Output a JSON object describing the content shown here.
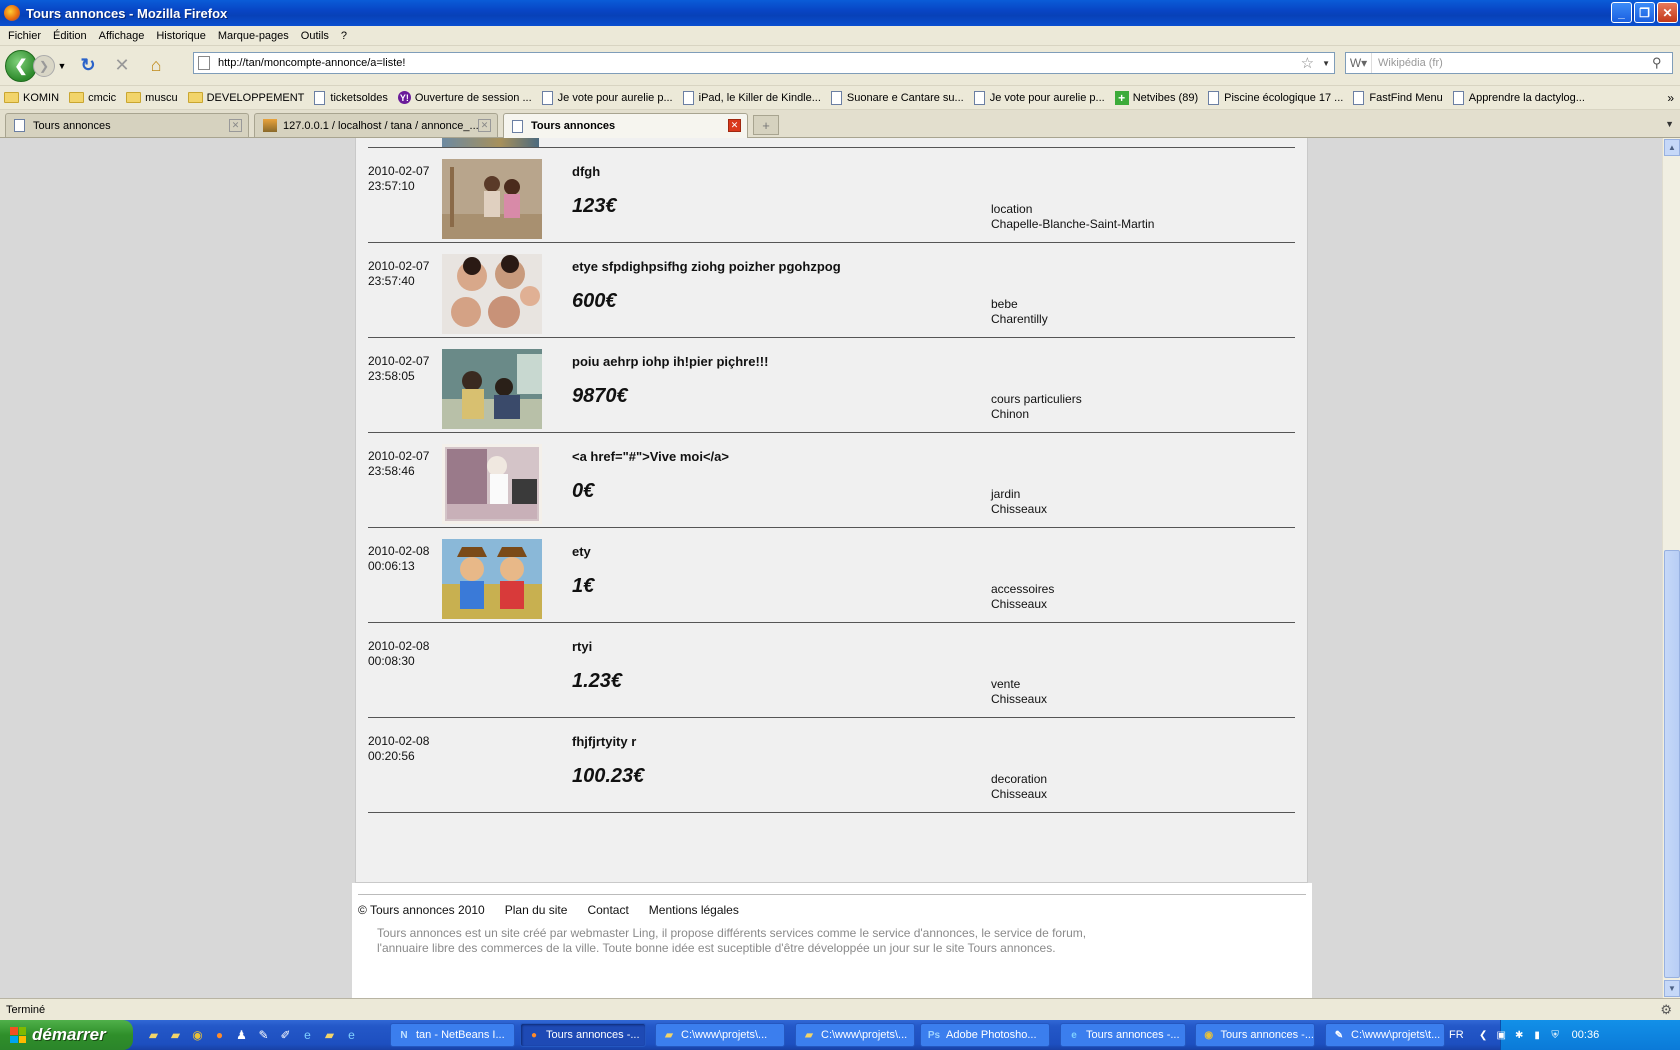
{
  "window": {
    "title": "Tours annonces - Mozilla Firefox",
    "buttons": {
      "minimize": "_",
      "maximize": "❐",
      "close": "✕"
    }
  },
  "menu": [
    "Fichier",
    "Édition",
    "Affichage",
    "Historique",
    "Marque-pages",
    "Outils",
    "?"
  ],
  "nav": {
    "url": "http://tan/moncompte-annonce/a=liste!",
    "search_placeholder": "Wikipédia (fr)"
  },
  "bookmarks": [
    {
      "label": "KOMIN",
      "icon": "folder-icon"
    },
    {
      "label": "cmcic",
      "icon": "folder-icon"
    },
    {
      "label": "muscu",
      "icon": "folder-icon"
    },
    {
      "label": "DEVELOPPEMENT",
      "icon": "folder-icon"
    },
    {
      "label": "ticketsoldes",
      "icon": "page-icon"
    },
    {
      "label": "Ouverture de session ...",
      "icon": "yahoo-icon"
    },
    {
      "label": "Je vote pour aurelie p...",
      "icon": "page-icon"
    },
    {
      "label": "iPad, le Killer de Kindle...",
      "icon": "page-icon"
    },
    {
      "label": "Suonare e Cantare su...",
      "icon": "page-icon"
    },
    {
      "label": "Je vote pour aurelie p...",
      "icon": "page-icon"
    },
    {
      "label": "Netvibes (89)",
      "icon": "netvibes-icon"
    },
    {
      "label": "Piscine écologique 17 ...",
      "icon": "page-icon"
    },
    {
      "label": "FastFind Menu",
      "icon": "page-icon"
    },
    {
      "label": "Apprendre la dactylog...",
      "icon": "page-icon"
    }
  ],
  "bookmarks_more": "»",
  "tabs": [
    {
      "label": "Tours annonces",
      "active": false
    },
    {
      "label": "127.0.0.1 / localhost / tana / annonce_...",
      "active": false
    },
    {
      "label": "Tours annonces",
      "active": true
    }
  ],
  "listings": [
    {
      "date": "2010-02-07",
      "time": "23:57:10",
      "title": "dfgh",
      "price": "123€",
      "category": "location",
      "city": "Chapelle-Blanche-Saint-Martin",
      "image": "photo-two-girls"
    },
    {
      "date": "2010-02-07",
      "time": "23:57:40",
      "title": "etye sfpdighpsifhg ziohg poizher pgohzpog",
      "price": "600€",
      "category": "bebe",
      "city": "Charentilly",
      "image": "photo-faces-group"
    },
    {
      "date": "2010-02-07",
      "time": "23:58:05",
      "title": "poiu aehrp iohp ih!pier piçhre!!!",
      "price": "9870€",
      "category": "cours particuliers",
      "city": "Chinon",
      "image": "photo-kids-bus"
    },
    {
      "date": "2010-02-07",
      "time": "23:58:46",
      "title": "<a href=\"#\">Vive moi</a>",
      "price": "0€",
      "category": "jardin",
      "city": "Chisseaux",
      "image": "photo-vintage-print"
    },
    {
      "date": "2010-02-08",
      "time": "00:06:13",
      "title": "ety",
      "price": "1€",
      "category": "accessoires",
      "city": "Chisseaux",
      "image": "photo-pirate-kids"
    },
    {
      "date": "2010-02-08",
      "time": "00:08:30",
      "title": "rtyi",
      "price": "1.23€",
      "category": "vente",
      "city": "Chisseaux",
      "image": ""
    },
    {
      "date": "2010-02-08",
      "time": "00:20:56",
      "title": "fhjfjrtyity r",
      "price": "100.23€",
      "category": "decoration",
      "city": "Chisseaux",
      "image": ""
    }
  ],
  "footer": {
    "copyright": "© Tours annonces 2010",
    "links": [
      "Plan du site",
      "Contact",
      "Mentions légales"
    ],
    "description_line1": "Tours annonces est un site créé par webmaster Ling, il propose différents services comme le service d'annonces, le service de forum,",
    "description_line2": "l'annuaire libre des commerces de la ville. Toute bonne idée est suceptible d'être développée un jour sur le site Tours annonces."
  },
  "status": "Terminé",
  "taskbar": {
    "start": "démarrer",
    "tasks": [
      {
        "label": "tan - NetBeans I...",
        "icon": "netbeans-icon",
        "active": false
      },
      {
        "label": "Tours annonces -...",
        "icon": "firefox-icon",
        "active": true
      },
      {
        "label": "C:\\www\\projets\\...",
        "icon": "folder-icon",
        "active": false
      },
      {
        "label": "C:\\www\\projets\\...",
        "icon": "folder-icon",
        "active": false
      },
      {
        "label": "Adobe Photosho...",
        "icon": "photoshop-icon",
        "active": false
      },
      {
        "label": "Tours annonces -...",
        "icon": "ie-icon",
        "active": false
      },
      {
        "label": "Tours annonces -...",
        "icon": "chrome-icon",
        "active": false
      },
      {
        "label": "C:\\www\\projets\\t...",
        "icon": "notepad-icon",
        "active": false
      }
    ],
    "lang": "FR",
    "clock": "00:36"
  }
}
